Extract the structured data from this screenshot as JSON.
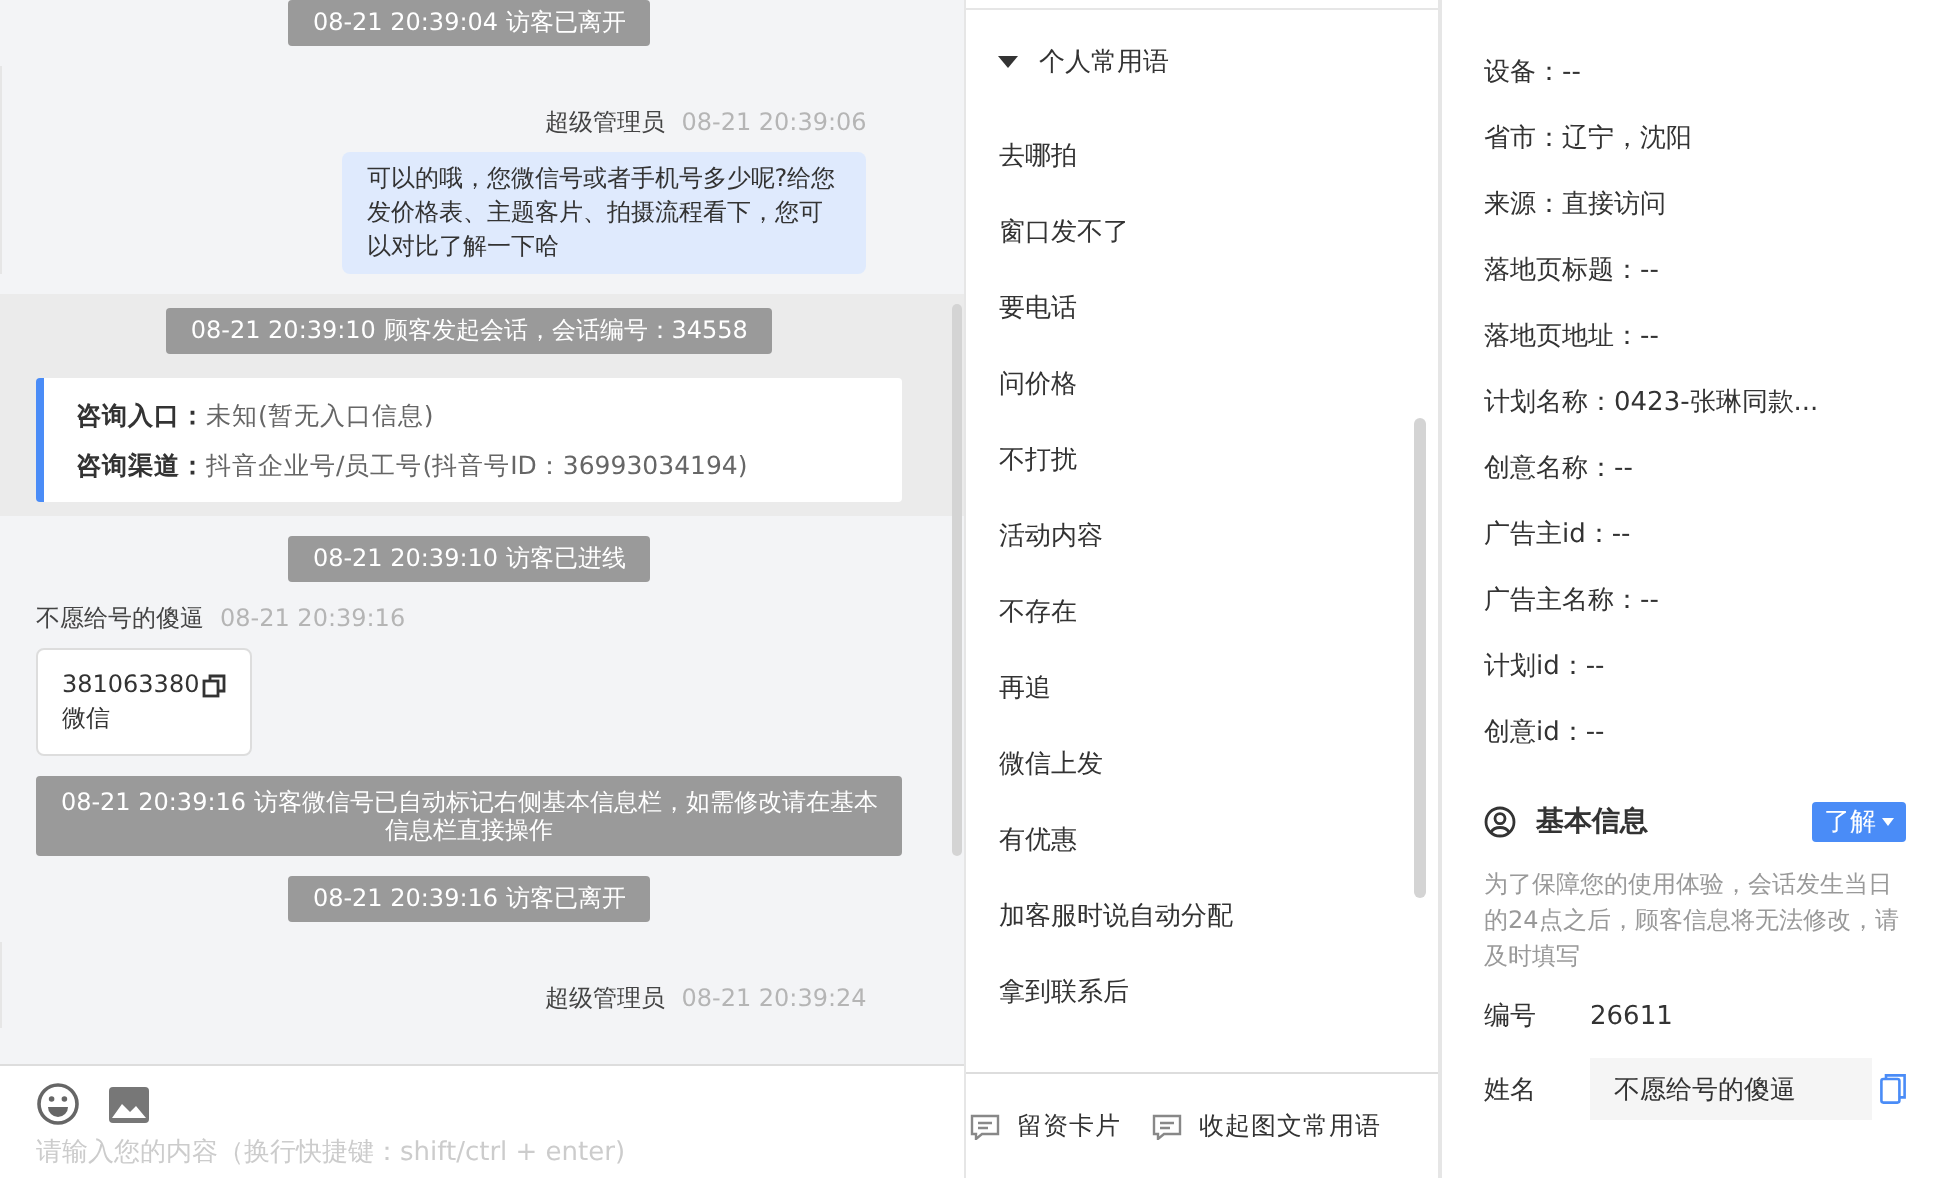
{
  "chat": {
    "messages": [
      {
        "kind": "system",
        "text": "08-21 20:39:04 访客已离开"
      },
      {
        "kind": "agent",
        "name": "超级管理员",
        "time": "08-21 20:39:06",
        "text": "可以的哦，您微信号或者手机号多少呢?给您发价格表、主题客片、拍摄流程看下，您可以对比了解一下哈"
      },
      {
        "kind": "session",
        "text": "08-21 20:39:10 顾客发起会话，会话编号：34558",
        "fields": [
          {
            "label": "咨询入口：",
            "value": "未知(暂无入口信息)"
          },
          {
            "label": "咨询渠道：",
            "value": "抖音企业号/员工号(抖音号ID：36993034194)"
          }
        ]
      },
      {
        "kind": "system",
        "text": "08-21 20:39:10 访客已进线"
      },
      {
        "kind": "visitor",
        "name": "不愿给号的傻逼",
        "time": "08-21 20:39:16",
        "number": "381063380",
        "label": "微信"
      },
      {
        "kind": "wide",
        "text": "08-21 20:39:16 访客微信号已自动标记右侧基本信息栏，如需修改请在基本信息栏直接操作"
      },
      {
        "kind": "system",
        "text": "08-21 20:39:16 访客已离开"
      },
      {
        "kind": "agent",
        "name": "超级管理员",
        "time": "08-21 20:39:24"
      }
    ]
  },
  "composer": {
    "placeholder": "请输入您的内容（换行快捷键：shift/ctrl + enter)"
  },
  "phrases": {
    "group": "个人常用语",
    "expanded": true,
    "items": [
      "去哪拍",
      "窗口发不了",
      "要电话",
      "问价格",
      "不打扰",
      "活动内容",
      "不存在",
      "再追",
      "微信上发",
      "有优惠",
      "加客服时说自动分配",
      "拿到联系后"
    ]
  },
  "footer_actions": [
    "留资卡片",
    "收起图文常用语"
  ],
  "visitor_info": {
    "fields": [
      "设备：--",
      "省市：辽宁，沈阳",
      "来源：直接访问",
      "落地页标题：--",
      "落地页地址：--",
      "计划名称：0423-张琳同款...",
      "创意名称：--",
      "广告主id：--",
      "广告主名称：--",
      "计划id：--",
      "创意id：--"
    ]
  },
  "basic_info": {
    "title": "基本信息",
    "button": "了解",
    "hint": "为了保障您的使用体验，会话发生当日的24点之后，顾客信息将无法修改，请及时填写",
    "id_label": "编号",
    "id_value": "26611",
    "name_label": "姓名",
    "name_value": "不愿给号的傻逼"
  }
}
